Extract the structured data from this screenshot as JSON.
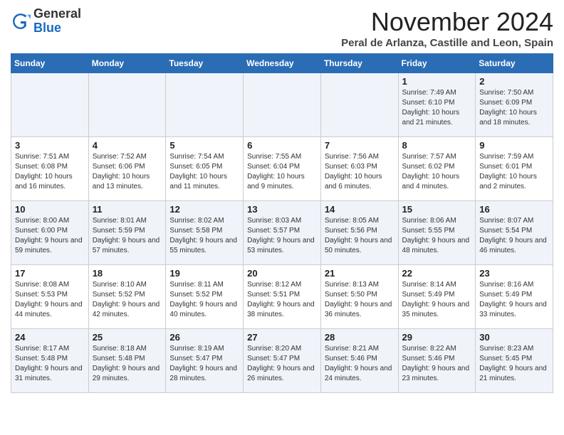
{
  "logo": {
    "general": "General",
    "blue": "Blue"
  },
  "header": {
    "month": "November 2024",
    "location": "Peral de Arlanza, Castille and Leon, Spain"
  },
  "days_of_week": [
    "Sunday",
    "Monday",
    "Tuesday",
    "Wednesday",
    "Thursday",
    "Friday",
    "Saturday"
  ],
  "weeks": [
    [
      {
        "day": "",
        "info": ""
      },
      {
        "day": "",
        "info": ""
      },
      {
        "day": "",
        "info": ""
      },
      {
        "day": "",
        "info": ""
      },
      {
        "day": "",
        "info": ""
      },
      {
        "day": "1",
        "info": "Sunrise: 7:49 AM\nSunset: 6:10 PM\nDaylight: 10 hours and 21 minutes."
      },
      {
        "day": "2",
        "info": "Sunrise: 7:50 AM\nSunset: 6:09 PM\nDaylight: 10 hours and 18 minutes."
      }
    ],
    [
      {
        "day": "3",
        "info": "Sunrise: 7:51 AM\nSunset: 6:08 PM\nDaylight: 10 hours and 16 minutes."
      },
      {
        "day": "4",
        "info": "Sunrise: 7:52 AM\nSunset: 6:06 PM\nDaylight: 10 hours and 13 minutes."
      },
      {
        "day": "5",
        "info": "Sunrise: 7:54 AM\nSunset: 6:05 PM\nDaylight: 10 hours and 11 minutes."
      },
      {
        "day": "6",
        "info": "Sunrise: 7:55 AM\nSunset: 6:04 PM\nDaylight: 10 hours and 9 minutes."
      },
      {
        "day": "7",
        "info": "Sunrise: 7:56 AM\nSunset: 6:03 PM\nDaylight: 10 hours and 6 minutes."
      },
      {
        "day": "8",
        "info": "Sunrise: 7:57 AM\nSunset: 6:02 PM\nDaylight: 10 hours and 4 minutes."
      },
      {
        "day": "9",
        "info": "Sunrise: 7:59 AM\nSunset: 6:01 PM\nDaylight: 10 hours and 2 minutes."
      }
    ],
    [
      {
        "day": "10",
        "info": "Sunrise: 8:00 AM\nSunset: 6:00 PM\nDaylight: 9 hours and 59 minutes."
      },
      {
        "day": "11",
        "info": "Sunrise: 8:01 AM\nSunset: 5:59 PM\nDaylight: 9 hours and 57 minutes."
      },
      {
        "day": "12",
        "info": "Sunrise: 8:02 AM\nSunset: 5:58 PM\nDaylight: 9 hours and 55 minutes."
      },
      {
        "day": "13",
        "info": "Sunrise: 8:03 AM\nSunset: 5:57 PM\nDaylight: 9 hours and 53 minutes."
      },
      {
        "day": "14",
        "info": "Sunrise: 8:05 AM\nSunset: 5:56 PM\nDaylight: 9 hours and 50 minutes."
      },
      {
        "day": "15",
        "info": "Sunrise: 8:06 AM\nSunset: 5:55 PM\nDaylight: 9 hours and 48 minutes."
      },
      {
        "day": "16",
        "info": "Sunrise: 8:07 AM\nSunset: 5:54 PM\nDaylight: 9 hours and 46 minutes."
      }
    ],
    [
      {
        "day": "17",
        "info": "Sunrise: 8:08 AM\nSunset: 5:53 PM\nDaylight: 9 hours and 44 minutes."
      },
      {
        "day": "18",
        "info": "Sunrise: 8:10 AM\nSunset: 5:52 PM\nDaylight: 9 hours and 42 minutes."
      },
      {
        "day": "19",
        "info": "Sunrise: 8:11 AM\nSunset: 5:52 PM\nDaylight: 9 hours and 40 minutes."
      },
      {
        "day": "20",
        "info": "Sunrise: 8:12 AM\nSunset: 5:51 PM\nDaylight: 9 hours and 38 minutes."
      },
      {
        "day": "21",
        "info": "Sunrise: 8:13 AM\nSunset: 5:50 PM\nDaylight: 9 hours and 36 minutes."
      },
      {
        "day": "22",
        "info": "Sunrise: 8:14 AM\nSunset: 5:49 PM\nDaylight: 9 hours and 35 minutes."
      },
      {
        "day": "23",
        "info": "Sunrise: 8:16 AM\nSunset: 5:49 PM\nDaylight: 9 hours and 33 minutes."
      }
    ],
    [
      {
        "day": "24",
        "info": "Sunrise: 8:17 AM\nSunset: 5:48 PM\nDaylight: 9 hours and 31 minutes."
      },
      {
        "day": "25",
        "info": "Sunrise: 8:18 AM\nSunset: 5:48 PM\nDaylight: 9 hours and 29 minutes."
      },
      {
        "day": "26",
        "info": "Sunrise: 8:19 AM\nSunset: 5:47 PM\nDaylight: 9 hours and 28 minutes."
      },
      {
        "day": "27",
        "info": "Sunrise: 8:20 AM\nSunset: 5:47 PM\nDaylight: 9 hours and 26 minutes."
      },
      {
        "day": "28",
        "info": "Sunrise: 8:21 AM\nSunset: 5:46 PM\nDaylight: 9 hours and 24 minutes."
      },
      {
        "day": "29",
        "info": "Sunrise: 8:22 AM\nSunset: 5:46 PM\nDaylight: 9 hours and 23 minutes."
      },
      {
        "day": "30",
        "info": "Sunrise: 8:23 AM\nSunset: 5:45 PM\nDaylight: 9 hours and 21 minutes."
      }
    ]
  ]
}
